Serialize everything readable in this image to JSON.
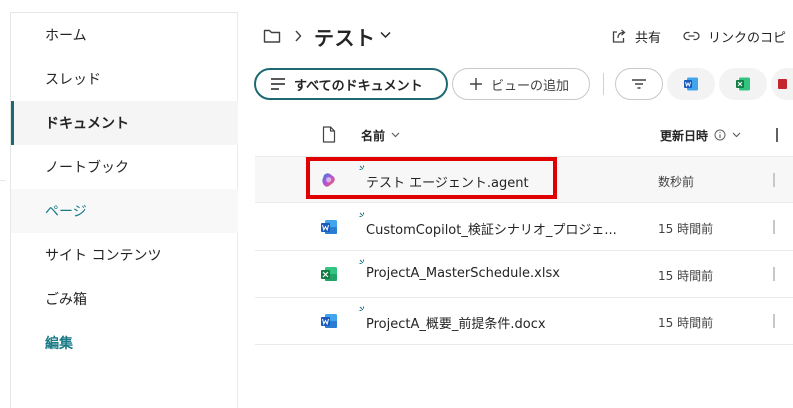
{
  "nav": {
    "items": [
      {
        "label": "ホーム"
      },
      {
        "label": "スレッド"
      },
      {
        "label": "ドキュメント"
      },
      {
        "label": "ノートブック"
      },
      {
        "label": "ページ"
      },
      {
        "label": "サイト コンテンツ"
      },
      {
        "label": "ごみ箱"
      },
      {
        "label": "編集"
      }
    ]
  },
  "header": {
    "title": "テスト",
    "share_label": "共有",
    "link_label": "リンクのコピ"
  },
  "toolbar": {
    "all_docs_label": "すべてのドキュメント",
    "add_view_label": "ビューの追加"
  },
  "columns": {
    "name": "名前",
    "modified": "更新日時"
  },
  "files": [
    {
      "name": "テスト エージェント.agent",
      "modified": "数秒前",
      "type": "agent"
    },
    {
      "name": "CustomCopilot_検証シナリオ_プロジェ...",
      "modified": "15 時間前",
      "type": "word"
    },
    {
      "name": "ProjectA_MasterSchedule.xlsx",
      "modified": "15 時間前",
      "type": "excel"
    },
    {
      "name": "ProjectA_概要_前提条件.docx",
      "modified": "15 時間前",
      "type": "word"
    }
  ],
  "colors": {
    "accent": "#1e6a72",
    "highlight": "#e00000",
    "word": "#185abd",
    "excel": "#107c41",
    "pdf": "#c4262e"
  }
}
